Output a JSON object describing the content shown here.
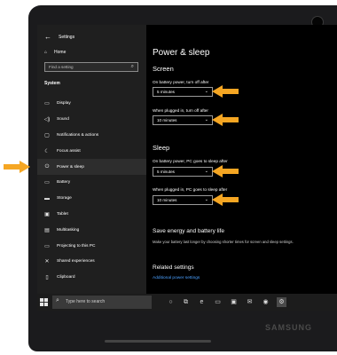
{
  "sidebar": {
    "title": "Settings",
    "home_label": "Home",
    "search_placeholder": "Find a setting",
    "section": "System",
    "items": [
      {
        "label": "Display",
        "icon": "display-icon"
      },
      {
        "label": "Sound",
        "icon": "sound-icon"
      },
      {
        "label": "Notifications & actions",
        "icon": "notifications-icon"
      },
      {
        "label": "Focus assist",
        "icon": "focus-assist-icon"
      },
      {
        "label": "Power & sleep",
        "icon": "power-icon",
        "active": true
      },
      {
        "label": "Battery",
        "icon": "battery-icon"
      },
      {
        "label": "Storage",
        "icon": "storage-icon"
      },
      {
        "label": "Tablet",
        "icon": "tablet-icon"
      },
      {
        "label": "Multitasking",
        "icon": "multitasking-icon"
      },
      {
        "label": "Projecting to this PC",
        "icon": "projecting-icon"
      },
      {
        "label": "Shared experiences",
        "icon": "shared-experiences-icon"
      },
      {
        "label": "Clipboard",
        "icon": "clipboard-icon"
      }
    ]
  },
  "main": {
    "title": "Power & sleep",
    "screen": {
      "heading": "Screen",
      "battery_label": "On battery power, turn off after",
      "battery_value": "5 minutes",
      "plugged_label": "When plugged in, turn off after",
      "plugged_value": "10 minutes"
    },
    "sleep": {
      "heading": "Sleep",
      "battery_label": "On battery power, PC goes to sleep after",
      "battery_value": "5 minutes",
      "plugged_label": "When plugged in, PC goes to sleep after",
      "plugged_value": "10 minutes"
    },
    "save_energy": {
      "heading": "Save energy and battery life",
      "description": "Make your battery last longer by choosing shorter times for screen and sleep settings."
    },
    "related": {
      "heading": "Related settings",
      "link": "Additional power settings"
    }
  },
  "taskbar": {
    "search_placeholder": "Type here to search"
  },
  "device": {
    "brand": "SAMSUNG"
  },
  "colors": {
    "accent_arrow": "#f5a623",
    "link": "#4aa0ff"
  }
}
